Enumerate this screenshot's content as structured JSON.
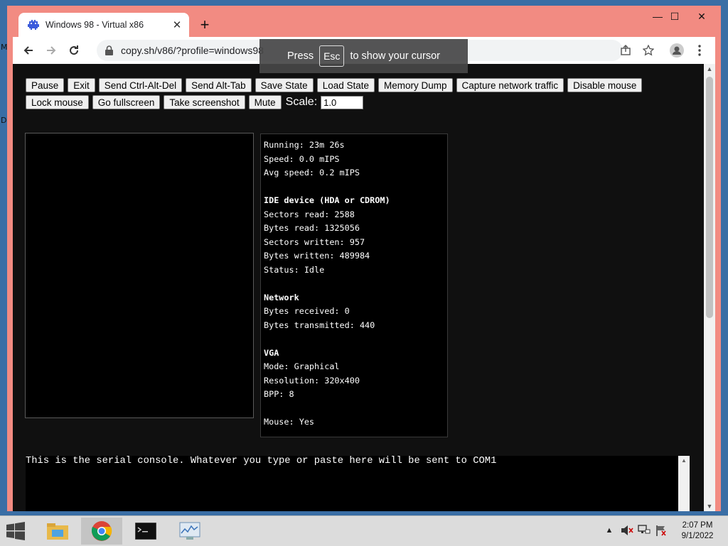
{
  "desktop": {
    "left_edge_letters": [
      "M",
      "D"
    ]
  },
  "browser": {
    "tab_title": "Windows 98 - Virtual x86",
    "url": "copy.sh/v86/?profile=windows98",
    "new_tab_symbol": "+",
    "close_symbol": "✕",
    "window_controls": {
      "minimize": "—",
      "maximize": "☐",
      "close": "✕"
    }
  },
  "toast": {
    "press": "Press",
    "key": "Esc",
    "message": "to show your cursor"
  },
  "controls": {
    "row1": [
      "Pause",
      "Exit",
      "Send Ctrl-Alt-Del",
      "Send Alt-Tab",
      "Save State",
      "Load State",
      "Memory Dump",
      "Capture network traffic",
      "Disable mouse"
    ],
    "row2": [
      "Lock mouse",
      "Go fullscreen",
      "Take screenshot",
      "Mute"
    ],
    "scale_label": "Scale:",
    "scale_value": "1.0"
  },
  "stats": {
    "running": "Running: 23m 26s",
    "speed": "Speed: 0.0 mIPS",
    "avg_speed": "Avg speed: 0.2 mIPS",
    "ide_header": "IDE device (HDA or CDROM)",
    "sectors_read": "Sectors read: 2588",
    "bytes_read": "Bytes read: 1325056",
    "sectors_written": "Sectors written: 957",
    "bytes_written": "Bytes written: 489984",
    "status": "Status: Idle",
    "network_header": "Network",
    "bytes_received": "Bytes received: 0",
    "bytes_transmitted": "Bytes transmitted: 440",
    "vga_header": "VGA",
    "mode": "Mode: Graphical",
    "resolution": "Resolution: 320x400",
    "bpp": "BPP: 8",
    "mouse": "Mouse: Yes"
  },
  "serial": {
    "text": "This is the serial console. Whatever you type or paste here will be sent to COM1"
  },
  "taskbar": {
    "time": "2:07 PM",
    "date": "9/1/2022"
  },
  "colors": {
    "window_frame": "#f28b82",
    "page_bg": "#101010",
    "taskbar": "#dcdcdc"
  }
}
